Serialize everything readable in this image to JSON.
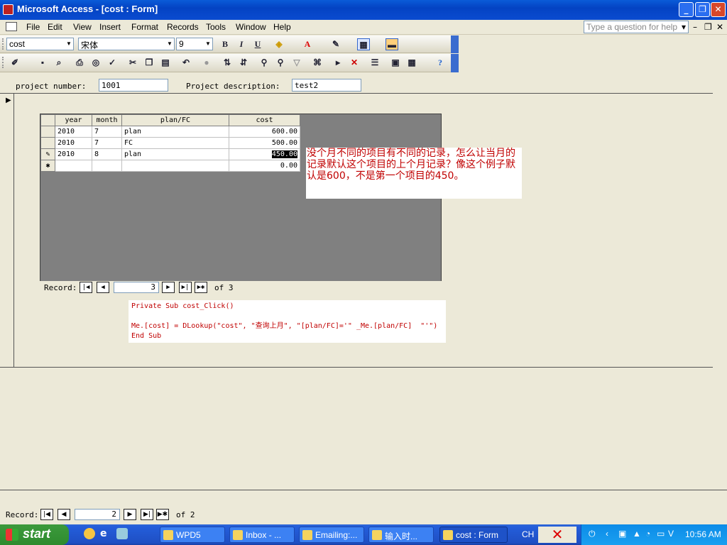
{
  "window": {
    "title": "Microsoft Access - [cost : Form]"
  },
  "menu": [
    "File",
    "Edit",
    "View",
    "Insert",
    "Format",
    "Records",
    "Tools",
    "Window",
    "Help"
  ],
  "help_placeholder": "Type a question for help",
  "format_toolbar": {
    "object": "cost",
    "font": "宋体",
    "size": "9",
    "bold": "B",
    "italic": "I",
    "underline": "U"
  },
  "header": {
    "project_number_label": "project number:",
    "project_number_value": "1001",
    "project_desc_label": "Project description:",
    "project_desc_value": "test2"
  },
  "subform": {
    "columns": [
      "year",
      "month",
      "plan/FC",
      "cost"
    ],
    "rows": [
      {
        "marker": "",
        "year": "2010",
        "month": "7",
        "plan": "plan",
        "cost": "600.00"
      },
      {
        "marker": "",
        "year": "2010",
        "month": "7",
        "plan": "FC",
        "cost": "500.00"
      },
      {
        "marker": "✎",
        "year": "2010",
        "month": "8",
        "plan": "plan",
        "cost": "450.00"
      },
      {
        "marker": "✱",
        "year": "",
        "month": "",
        "plan": "",
        "cost": "0.00"
      }
    ],
    "nav": {
      "label": "Record:",
      "current": "3",
      "of_label": "of 3"
    }
  },
  "note": "没个月不同的项目有不同的记录，怎么让当月的记录默认这个项目的上个月记录？像这个例子默认是600，不是第一个项目的450。",
  "code": "Private Sub cost_Click()\n\nMe.[cost] = DLookup(\"cost\", \"查询上月\", \"[plan/FC]='\" _Me.[plan/FC]  \"'\")\nEnd Sub",
  "main_nav": {
    "label": "Record:",
    "current": "2",
    "of_label": "of 2"
  },
  "taskbar": {
    "start": "start",
    "tasks": [
      "WPD5",
      "Inbox - ...",
      "Emailing:...",
      "输入时...",
      "cost : Form",
      "CH"
    ],
    "clock": "10:56 AM"
  }
}
